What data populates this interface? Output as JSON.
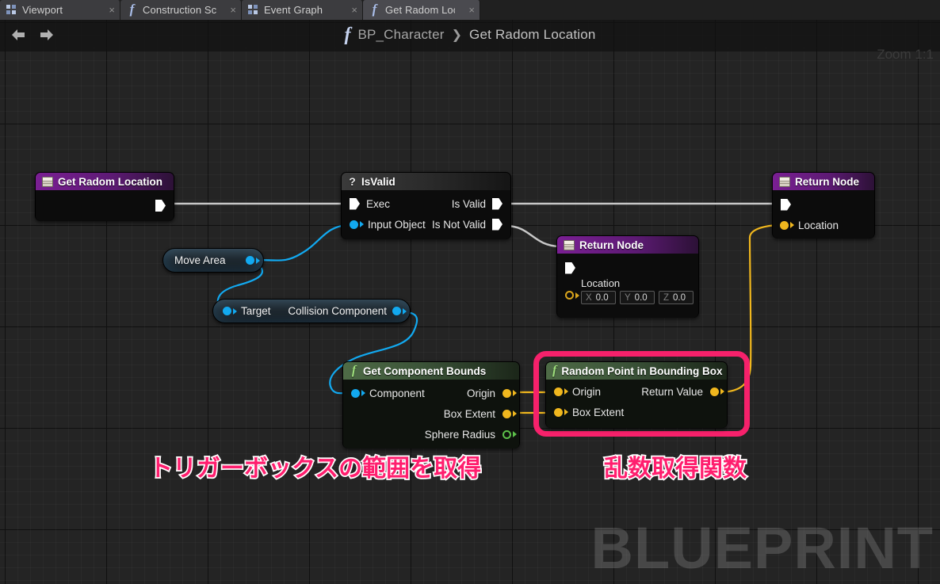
{
  "window": {
    "zoom_label": "Zoom 1:1"
  },
  "tabs": [
    {
      "label": "Viewport",
      "icon": "grid-icon",
      "close": "×",
      "active": false
    },
    {
      "label": "Construction Script",
      "icon": "function-icon",
      "close": "×",
      "active": false
    },
    {
      "label": "Event Graph",
      "icon": "grid-icon",
      "close": "×",
      "active": false
    },
    {
      "label": "Get Radom Locatio",
      "icon": "function-icon",
      "close": "×",
      "active": true
    }
  ],
  "toolbar": {
    "back_icon": "back-arrow-icon",
    "forward_icon": "forward-arrow-icon"
  },
  "breadcrumb": {
    "icon": "function-icon",
    "blueprint": "BP_Character",
    "separator": "❯",
    "graph": "Get Radom Location"
  },
  "nodes": {
    "get_radom_location": {
      "title": "Get Radom Location",
      "icon": "return-box-icon",
      "exec_out": "exec-out-pin"
    },
    "is_valid": {
      "title": "IsValid",
      "icon": "question-icon",
      "in_exec": "Exec",
      "in_object": "Input Object",
      "out_valid": "Is Valid",
      "out_not_valid": "Is Not Valid"
    },
    "move_area": {
      "title": "Move Area"
    },
    "collision_component": {
      "in_label": "Target",
      "out_label": "Collision Component"
    },
    "get_component_bounds": {
      "title": "Get Component Bounds",
      "icon": "function-icon",
      "in_component": "Component",
      "out_origin": "Origin",
      "out_box_extent": "Box Extent",
      "out_sphere_radius": "Sphere Radius"
    },
    "random_point": {
      "title": "Random Point in Bounding Box",
      "icon": "function-icon",
      "in_origin": "Origin",
      "in_box_extent": "Box Extent",
      "out_return": "Return Value"
    },
    "return_node_mid": {
      "title": "Return Node",
      "icon": "return-box-icon",
      "location_label": "Location",
      "x_axis": "X",
      "x_value": "0.0",
      "y_axis": "Y",
      "y_value": "0.0",
      "z_axis": "Z",
      "z_value": "0.0"
    },
    "return_node_right": {
      "title": "Return Node",
      "icon": "return-box-icon",
      "location_label": "Location"
    }
  },
  "annotations": {
    "left": "トリガーボックスの範囲を取得",
    "right": "乱数取得関数",
    "watermark": "BLUEPRINT"
  },
  "colors": {
    "highlight_pink": "#f6216b",
    "annotation_text": "#ff1e6e",
    "exec_wire": "#c8c8c8",
    "object_wire": "#12a9f0",
    "vector_wire": "#f0b71e",
    "node_header_purple": "#7a1f93",
    "node_header_green": "#4e6b46"
  }
}
